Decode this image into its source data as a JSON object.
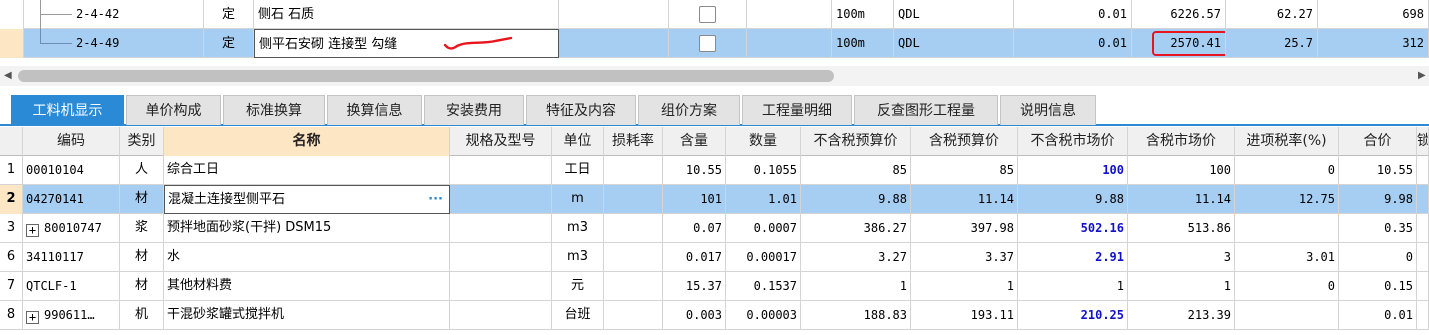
{
  "top_rows": [
    {
      "code": "2-4-42",
      "type": "定",
      "name": "侧石 石质",
      "unit": "100m",
      "qdl": "QDL",
      "qty": "0.01",
      "price": "6226.57",
      "amount": "62.27",
      "extra": "698"
    },
    {
      "code": "2-4-49",
      "type": "定",
      "name": "侧平石安砌 连接型 勾缝",
      "unit": "100m",
      "qdl": "QDL",
      "qty": "0.01",
      "price": "2570.41",
      "amount": "25.7",
      "extra": "312"
    }
  ],
  "tabs": [
    "工料机显示",
    "单价构成",
    "标准换算",
    "换算信息",
    "安装费用",
    "特征及内容",
    "组价方案",
    "工程量明细",
    "反查图形工程量",
    "说明信息"
  ],
  "headers": [
    "编码",
    "类别",
    "名称",
    "规格及型号",
    "单位",
    "损耗率",
    "含量",
    "数量",
    "不含税预算价",
    "含税预算价",
    "不含税市场价",
    "含税市场价",
    "进项税率(%)",
    "合价",
    "锁"
  ],
  "rows": [
    {
      "no": "1",
      "code": "00010104",
      "expand": false,
      "cat": "人",
      "name": "综合工日",
      "unit": "工日",
      "content": "10.55",
      "qty": "0.1055",
      "budget": "85",
      "budget_tax": "85",
      "market": "100",
      "market_tax": "100",
      "tax_rate": "0",
      "total": "10.55"
    },
    {
      "no": "2",
      "code": "04270141",
      "expand": false,
      "cat": "材",
      "name": "混凝土连接型侧平石",
      "unit": "m",
      "content": "101",
      "qty": "1.01",
      "budget": "9.88",
      "budget_tax": "11.14",
      "market": "9.88",
      "market_tax": "11.14",
      "tax_rate": "12.75",
      "total": "9.98"
    },
    {
      "no": "3",
      "code": "80010747",
      "expand": true,
      "cat": "浆",
      "name": "预拌地面砂浆(干拌) DSM15",
      "unit": "m3",
      "content": "0.07",
      "qty": "0.0007",
      "budget": "386.27",
      "budget_tax": "397.98",
      "market": "502.16",
      "market_tax": "513.86",
      "tax_rate": "",
      "total": "0.35"
    },
    {
      "no": "6",
      "code": "34110117",
      "expand": false,
      "cat": "材",
      "name": "水",
      "unit": "m3",
      "content": "0.017",
      "qty": "0.00017",
      "budget": "3.27",
      "budget_tax": "3.37",
      "market": "2.91",
      "market_tax": "3",
      "tax_rate": "3.01",
      "total": "0"
    },
    {
      "no": "7",
      "code": "QTCLF-1",
      "expand": false,
      "cat": "材",
      "name": "其他材料费",
      "unit": "元",
      "content": "15.37",
      "qty": "0.1537",
      "budget": "1",
      "budget_tax": "1",
      "market": "1",
      "market_tax": "1",
      "tax_rate": "0",
      "total": "0.15"
    },
    {
      "no": "8",
      "code": "990611…",
      "expand": true,
      "cat": "机",
      "name": "干混砂浆罐式搅拌机",
      "unit": "台班",
      "content": "0.003",
      "qty": "0.00003",
      "budget": "188.83",
      "budget_tax": "193.11",
      "market": "210.25",
      "market_tax": "213.39",
      "tax_rate": "",
      "total": "0.01"
    }
  ],
  "colors": {
    "accent": "#2b8ad6",
    "selection": "#a6cdf2",
    "annotation": "#e8161c",
    "market_highlight": "#1111cc"
  }
}
